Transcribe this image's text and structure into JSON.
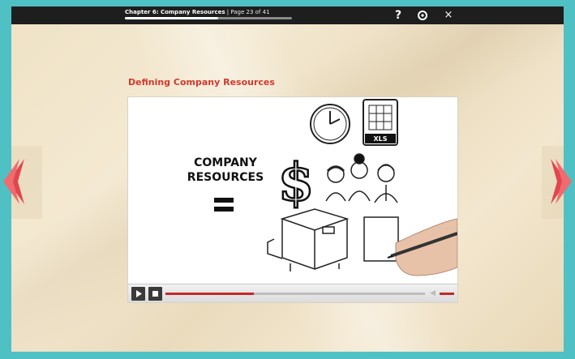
{
  "topbar": {
    "chapter_label": "Chapter 6: Company Resources",
    "page_label": "| Page 23 of 41",
    "progress_fraction": 0.56,
    "help_label": "?",
    "settings_icon": "gear-icon",
    "close_label": "×"
  },
  "lesson": {
    "title": "Defining Company Resources"
  },
  "video": {
    "scene_text_line1": "COMPANY",
    "scene_text_line2": "RESOURCES",
    "file_badge": "XLS",
    "seek_fraction": 0.34,
    "colors": {
      "accent": "#c62828",
      "title": "#d1392e"
    }
  },
  "navigation": {
    "prev_icon": "chevron-left-icon",
    "next_icon": "chevron-right-icon"
  }
}
